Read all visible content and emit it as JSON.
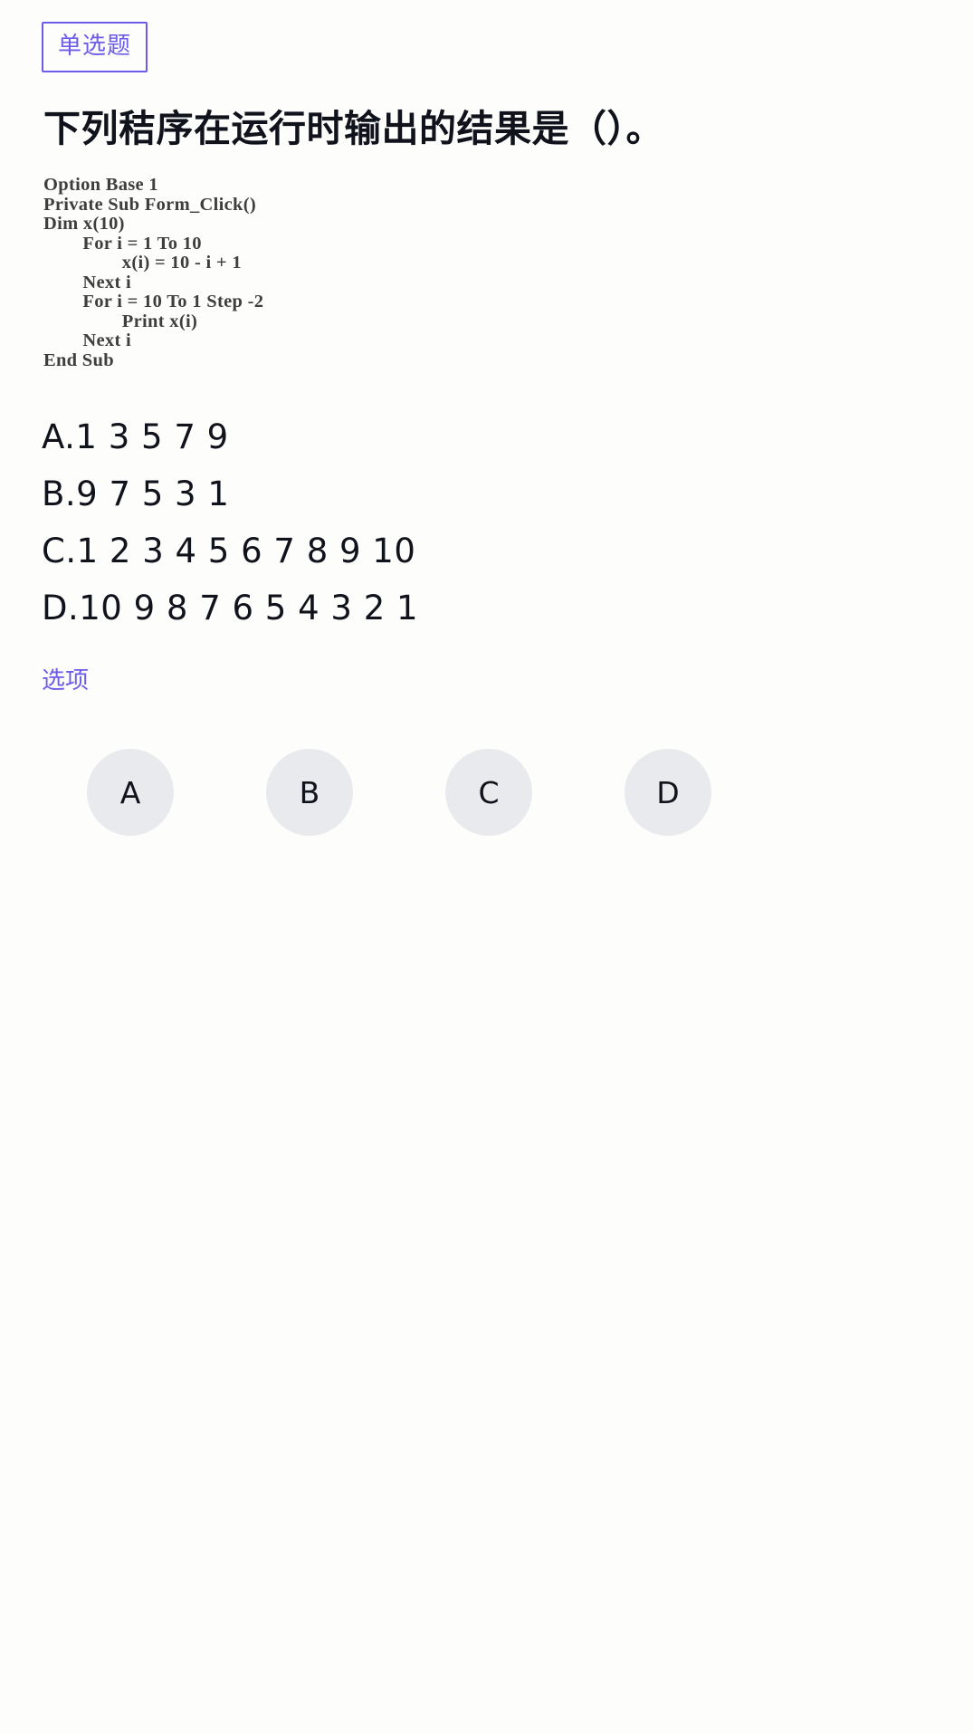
{
  "badge": {
    "label": "单选题"
  },
  "question": {
    "title": "下列秸序在运行时输出的结果是（）。",
    "code_lines": [
      "Option Base 1",
      "Private Sub Form_Click()",
      "Dim x(10)",
      "        For i = 1 To 10",
      "                x(i) = 10 - i + 1",
      "        Next i",
      "        For i = 10 To 1 Step -2",
      "                Print x(i)",
      "        Next i",
      "End Sub"
    ],
    "choices": [
      {
        "key": "A",
        "text": "A.1 3 5 7 9"
      },
      {
        "key": "B",
        "text": "B.9 7 5 3 1"
      },
      {
        "key": "C",
        "text": "C.1 2 3 4 5 6 7 8 9 10"
      },
      {
        "key": "D",
        "text": "D.10 9 8 7 6 5 4 3 2 1"
      }
    ]
  },
  "options": {
    "label": "选项",
    "buttons": [
      {
        "label": "A"
      },
      {
        "label": "B"
      },
      {
        "label": "C"
      },
      {
        "label": "D"
      }
    ]
  },
  "colors": {
    "accent": "#6c5ce8",
    "text": "#10121c",
    "background": "#fdfdfb",
    "circle_bg": "#e8eaed"
  }
}
